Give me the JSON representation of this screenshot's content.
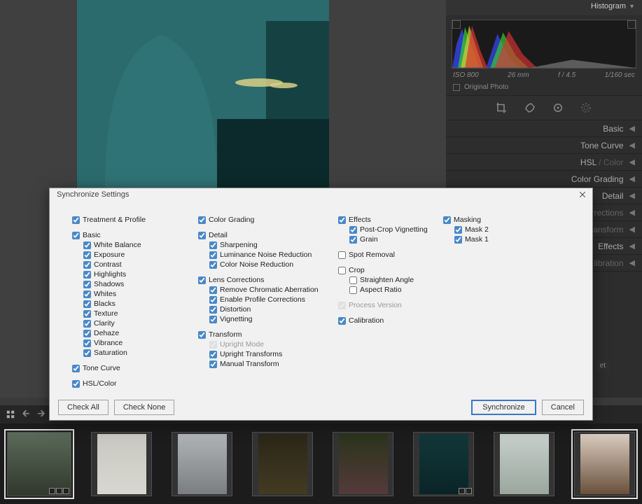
{
  "right": {
    "histogram_title": "Histogram",
    "meta_iso": "ISO 800",
    "meta_fl": "26 mm",
    "meta_fstop": "f / 4.5",
    "meta_shutter": "1/160 sec",
    "original_photo": "Original Photo",
    "panels": {
      "basic": "Basic",
      "tone_curve": "Tone Curve",
      "hsl": "HSL",
      "color_word": "Color",
      "color_grading": "Color Grading",
      "detail": "Detail",
      "corrections": "orrections",
      "transform": "ransform",
      "effects": "Effects",
      "calibration": "libration"
    },
    "soft_label": "et"
  },
  "dialog": {
    "title": "Synchronize Settings",
    "treatment_profile": "Treatment & Profile",
    "basic": "Basic",
    "white_balance": "White Balance",
    "exposure": "Exposure",
    "contrast": "Contrast",
    "highlights": "Highlights",
    "shadows": "Shadows",
    "whites": "Whites",
    "blacks": "Blacks",
    "texture": "Texture",
    "clarity": "Clarity",
    "dehaze": "Dehaze",
    "vibrance": "Vibrance",
    "saturation": "Saturation",
    "tone_curve": "Tone Curve",
    "hsl_color": "HSL/Color",
    "color_grading": "Color Grading",
    "detail": "Detail",
    "sharpening": "Sharpening",
    "luminance_nr": "Luminance Noise Reduction",
    "color_nr": "Color Noise Reduction",
    "lens_corrections": "Lens Corrections",
    "remove_ca": "Remove Chromatic Aberration",
    "enable_profile": "Enable Profile Corrections",
    "distortion": "Distortion",
    "vignetting": "Vignetting",
    "transform": "Transform",
    "upright_mode": "Upright Mode",
    "upright_transforms": "Upright Transforms",
    "manual_transform": "Manual Transform",
    "effects": "Effects",
    "pcv": "Post-Crop Vignetting",
    "grain": "Grain",
    "spot_removal": "Spot Removal",
    "crop": "Crop",
    "straighten": "Straighten Angle",
    "aspect": "Aspect Ratio",
    "process_version": "Process Version",
    "calibration": "Calibration",
    "masking": "Masking",
    "mask2": "Mask 2",
    "mask1": "Mask 1",
    "check_all": "Check All",
    "check_none": "Check None",
    "synchronize": "Synchronize",
    "cancel": "Cancel"
  }
}
